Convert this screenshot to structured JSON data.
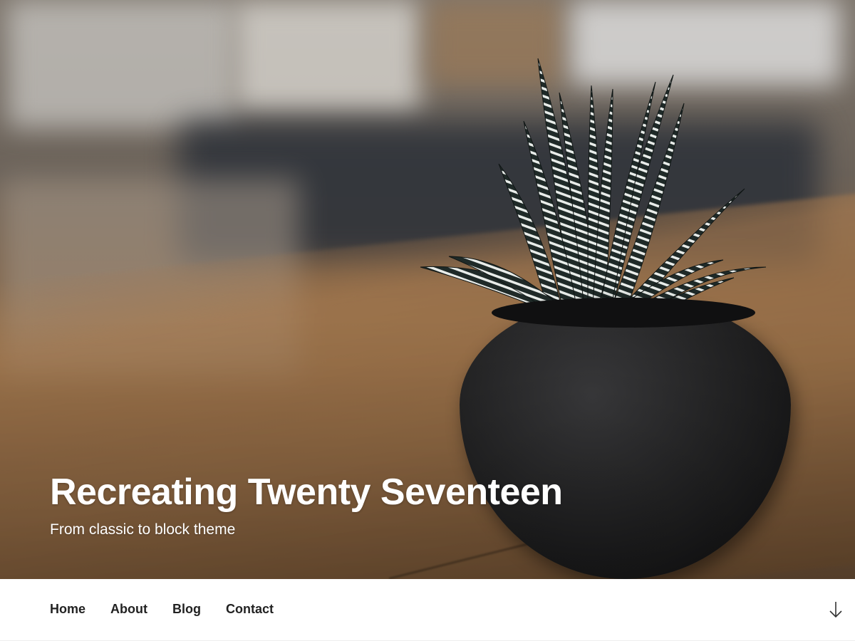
{
  "site": {
    "title": "Recreating Twenty Seventeen",
    "description": "From classic to block theme"
  },
  "header_image": {
    "subject": "succulent-in-black-pot",
    "colors": {
      "wood": "#8b6a47",
      "pot": "#1a1a1b",
      "background": "#6b6259"
    }
  },
  "navigation": {
    "items": [
      {
        "label": "Home"
      },
      {
        "label": "About"
      },
      {
        "label": "Blog"
      },
      {
        "label": "Contact"
      }
    ],
    "scroll_icon": "arrow-down-icon"
  },
  "colors": {
    "text": "#222222",
    "nav_background": "#ffffff"
  }
}
